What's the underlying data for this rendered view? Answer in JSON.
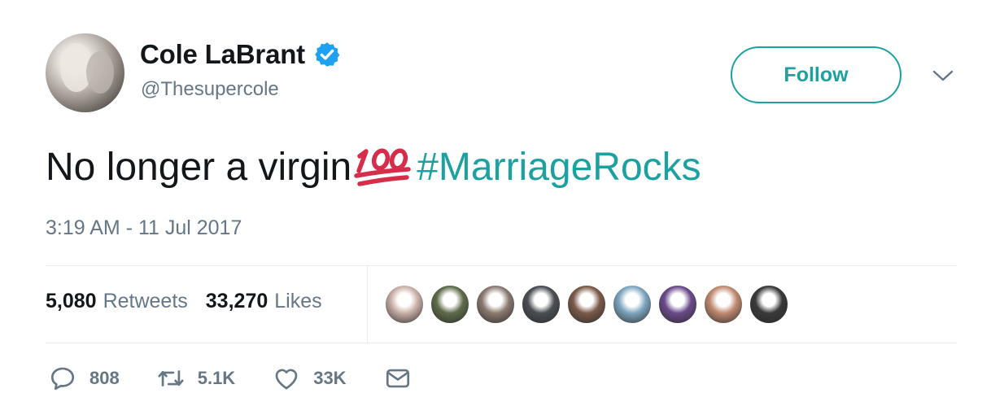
{
  "user": {
    "display_name": "Cole LaBrant",
    "handle": "@Thesupercole",
    "verified": true
  },
  "follow_label": "Follow",
  "tweet": {
    "text": "No longer a virgin",
    "emoji": "hundred-points",
    "hashtag": "#MarriageRocks",
    "timestamp": "3:19 AM - 11 Jul 2017"
  },
  "stats": {
    "retweets_count": "5,080",
    "retweets_label": "Retweets",
    "likes_count": "33,270",
    "likes_label": "Likes"
  },
  "liker_avatar_colors": [
    "#c9b0a8",
    "#5e6b4a",
    "#8a7a70",
    "#4a4e52",
    "#7a5a48",
    "#7ea6c0",
    "#6a4a8a",
    "#c08a70",
    "#3a3838"
  ],
  "actions": {
    "reply_count": "808",
    "retweet_count": "5.1K",
    "like_count": "33K"
  },
  "colors": {
    "accent": "#1da1a0",
    "verified": "#1da1f2",
    "secondary_text": "#657786",
    "emoji_red": "#d62d4a"
  }
}
